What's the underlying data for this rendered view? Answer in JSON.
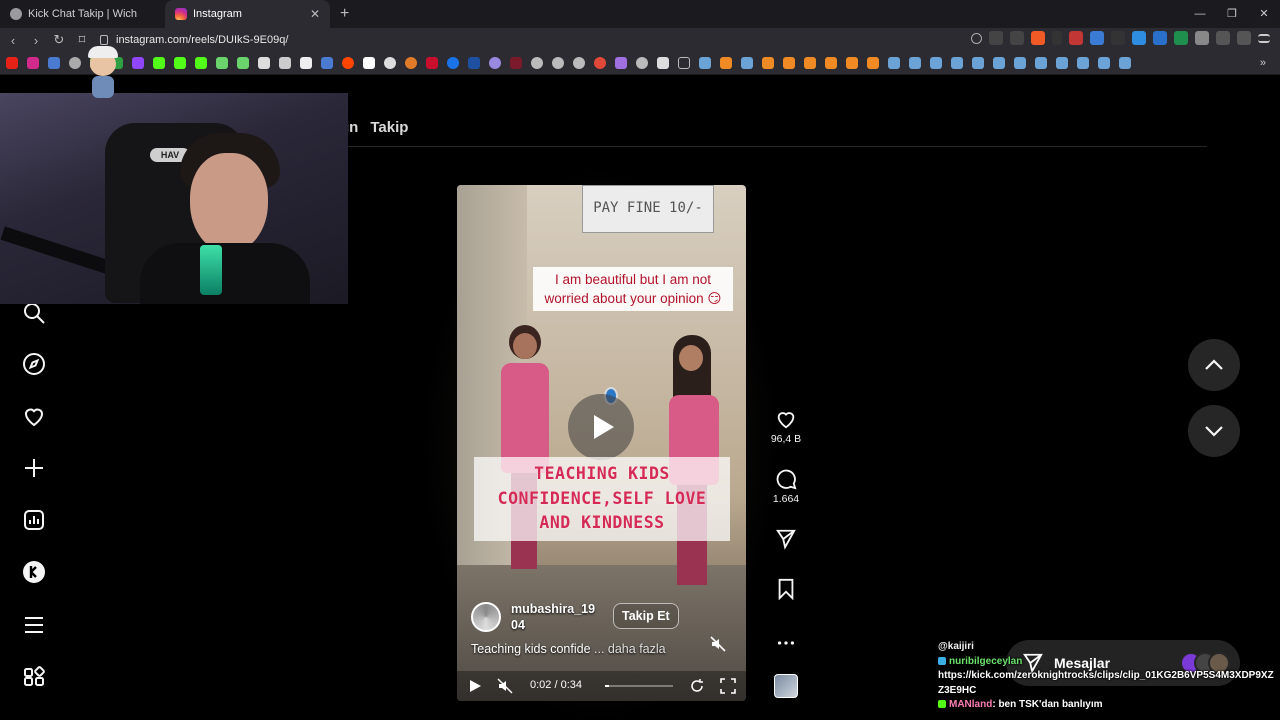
{
  "browser": {
    "tabs": [
      {
        "title": "Kick Chat Takip | Wich",
        "active": false
      },
      {
        "title": "Instagram",
        "active": true
      }
    ],
    "url": "instagram.com/reels/DUIkS-9E09q/"
  },
  "header": {
    "partial_left": "in",
    "following_tab": "Takip"
  },
  "sidebar": {
    "icons": [
      "search-icon",
      "explore-icon",
      "notifications-icon",
      "create-icon",
      "dashboard-icon",
      "kick-icon",
      "menu-icon",
      "more-apps-icon"
    ]
  },
  "webcam": {
    "chair_brand": "HAV"
  },
  "reel": {
    "sign_text": "PAY FINE 10/-",
    "caption_top": "I am beautiful but I am not worried about your opinion 😏",
    "caption_main": [
      "TEACHING KIDS",
      "CONFIDENCE,SELF LOVE",
      "AND KINDNESS"
    ],
    "author_name": "mubashira_19\n04",
    "follow_label": "Takip Et",
    "description": "Teaching kids confide",
    "more_label": "... daha fazla",
    "time_label": "0:02 / 0:34",
    "progress": 0.06
  },
  "actions": {
    "likes": "96,4 B",
    "comments": "1.664"
  },
  "messages": {
    "label": "Mesajlar"
  },
  "chat": {
    "lines": [
      {
        "user": "@kaijiri",
        "text": ""
      },
      {
        "user": "nuribilgeceylan",
        "text": ""
      },
      {
        "user": "",
        "text": "https://kick.com/zeroknightrocks/clips/clip_01KG2B6VP5S4M3XDP9XZZ3E9HC"
      },
      {
        "user": "MANland",
        "text": ": ben TSK'dan banlıyım"
      }
    ]
  },
  "colors": {
    "page_bg": "#000000",
    "caption_red": "#d42a55",
    "chrome_bg": "#2b2b31"
  }
}
